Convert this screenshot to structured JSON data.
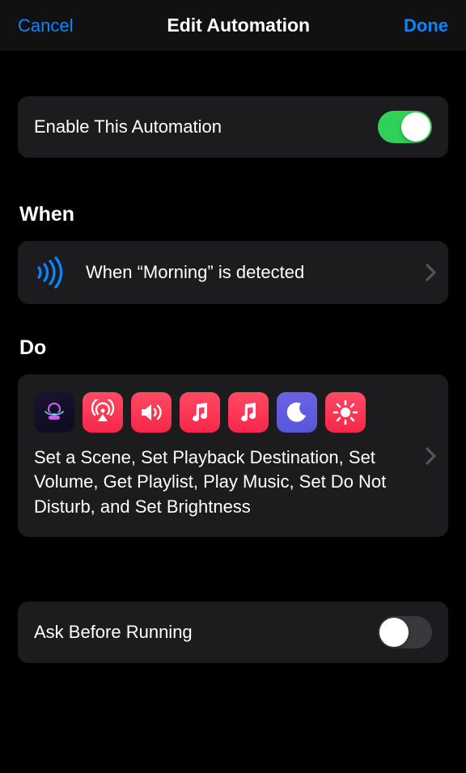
{
  "header": {
    "cancel": "Cancel",
    "title": "Edit Automation",
    "done": "Done"
  },
  "enable": {
    "label": "Enable This Automation",
    "on": true
  },
  "sections": {
    "when": "When",
    "do": "Do"
  },
  "when_row": {
    "text": "When “Morning” is detected"
  },
  "do_block": {
    "icons": [
      "shortcut-scene",
      "airplay",
      "volume",
      "music",
      "music",
      "moon",
      "brightness"
    ],
    "description": "Set a Scene, Set Playback Destination, Set Volume, Get Playlist, Play Music, Set Do Not Disturb, and Set Brightness"
  },
  "ask": {
    "label": "Ask Before Running",
    "on": false
  }
}
